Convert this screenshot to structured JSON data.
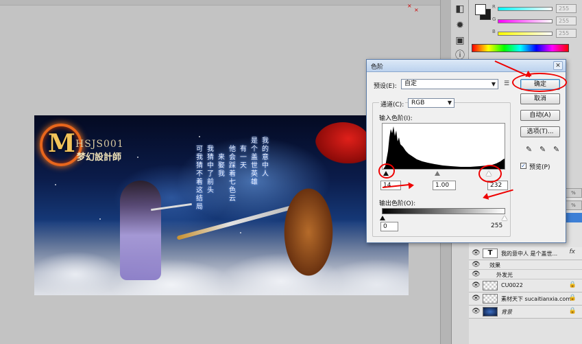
{
  "levels_dialog": {
    "title": "色阶",
    "close_glyph": "✕",
    "preset_label": "预设(E):",
    "preset_value": "自定",
    "preset_menu_glyph": "☰",
    "channel_label": "通道(C):",
    "channel_value": "RGB",
    "input_levels_label": "输入色阶(I):",
    "input_black": "14",
    "input_mid": "1.00",
    "input_white": "232",
    "output_levels_label": "输出色阶(O):",
    "output_black": "0",
    "output_white": "255",
    "buttons": {
      "ok": "确定",
      "cancel": "取消",
      "auto": "自动(A)",
      "options": "选项(T)..."
    },
    "preview_label": "预览(P)",
    "preview_checked": true,
    "preview_check_glyph": "✓"
  },
  "color_panel": {
    "rows": [
      {
        "label": "R",
        "value": "255",
        "gradient": "#ff0000"
      },
      {
        "label": "G",
        "value": "255",
        "gradient": "#00d000"
      },
      {
        "label": "B",
        "value": "255",
        "gradient": "#0000ff"
      }
    ]
  },
  "layers": {
    "rows": [
      {
        "kind": "text",
        "thumb_glyph": "T",
        "name": "我的意中人 是个盖世...",
        "suffix": "fx"
      },
      {
        "kind": "sub",
        "name": "效果"
      },
      {
        "kind": "sub2",
        "name": "外发光"
      },
      {
        "kind": "image",
        "name": "CU0022"
      },
      {
        "kind": "image",
        "name": "素材天下 sucaitianxia.com"
      },
      {
        "kind": "background",
        "name": "背景"
      }
    ]
  },
  "canvas_image": {
    "logo_letter": "M",
    "logo_code": "HSJS001",
    "logo_cn": "梦幻設計師",
    "poem_columns": [
      "我的意中人",
      "是个盖世英雄",
      "有一天",
      "他会踩着七色云",
      "来娶我",
      "我猜中了前头",
      "可我猜不着这结局"
    ]
  },
  "icons": {
    "eye": "👁",
    "lock": "🔒",
    "eyedropper": "✎"
  }
}
